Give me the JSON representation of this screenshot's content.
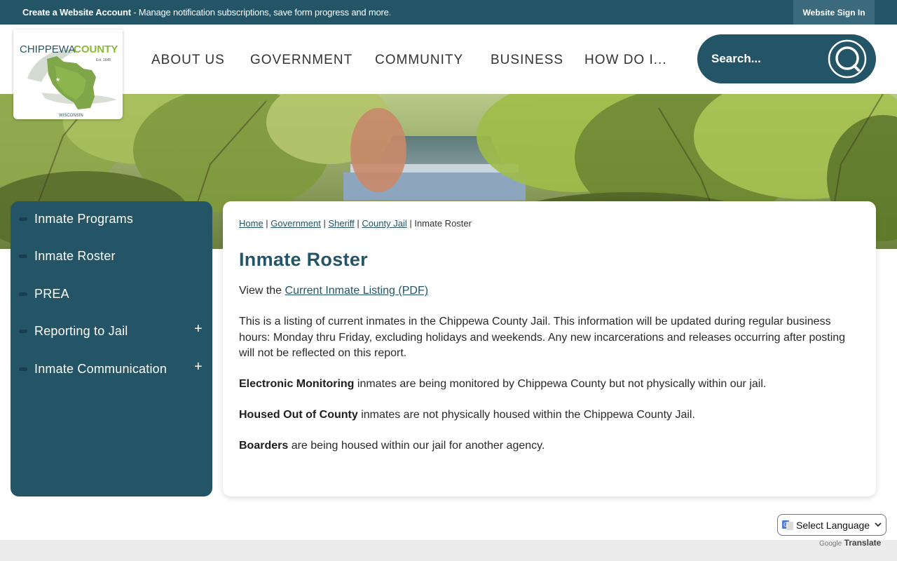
{
  "topbar": {
    "notice_bold": "Create a Website Account",
    "notice_rest": " - Manage notification subscriptions, save form progress and more.",
    "signin_label": "Website Sign In"
  },
  "logo": {
    "name_part1": "CHIPPEWA",
    "name_part2": "COUNTY",
    "est": "Est. 1845",
    "state": "WISCONSIN"
  },
  "nav": {
    "items": [
      {
        "label": "ABOUT US"
      },
      {
        "label": "GOVERNMENT"
      },
      {
        "label": "COMMUNITY"
      },
      {
        "label": "BUSINESS"
      },
      {
        "label": "HOW DO I..."
      }
    ]
  },
  "search": {
    "placeholder": "Search..."
  },
  "sidebar": {
    "items": [
      {
        "label": "Inmate Programs",
        "expandable": false
      },
      {
        "label": "Inmate Roster",
        "expandable": false
      },
      {
        "label": "PREA",
        "expandable": false
      },
      {
        "label": "Reporting to Jail",
        "expandable": true
      },
      {
        "label": "Inmate Communication",
        "expandable": true
      }
    ],
    "expand_symbol": "+"
  },
  "breadcrumb": {
    "links": [
      "Home",
      "Government",
      "Sheriff",
      "County Jail"
    ],
    "separator": " | ",
    "current": "Inmate Roster"
  },
  "page": {
    "title": "Inmate Roster",
    "view_prefix": "View the ",
    "view_link": "Current Inmate Listing (PDF)",
    "para1": "This is a listing of current inmates in the Chippewa County Jail. This information will be updated during regular business hours: Monday thru Friday, excluding holidays and weekends. Any new incarcerations and releases occurring after posting will not be reflected on this report.",
    "em_bold": "Electronic Monitoring",
    "em_rest": " inmates are being monitored by Chippewa County but not physically within our jail.",
    "hoc_bold": "Housed Out of County",
    "hoc_rest": " inmates are not physically housed within the Chippewa County Jail.",
    "board_bold": "Boarders",
    "board_rest": " are being housed within our jail for another agency."
  },
  "translate": {
    "select_label": "Select Language",
    "powered_google": "Google",
    "powered_translate": "Translate"
  },
  "colors": {
    "brand": "#245567",
    "logo_green": "#8ab83a"
  }
}
